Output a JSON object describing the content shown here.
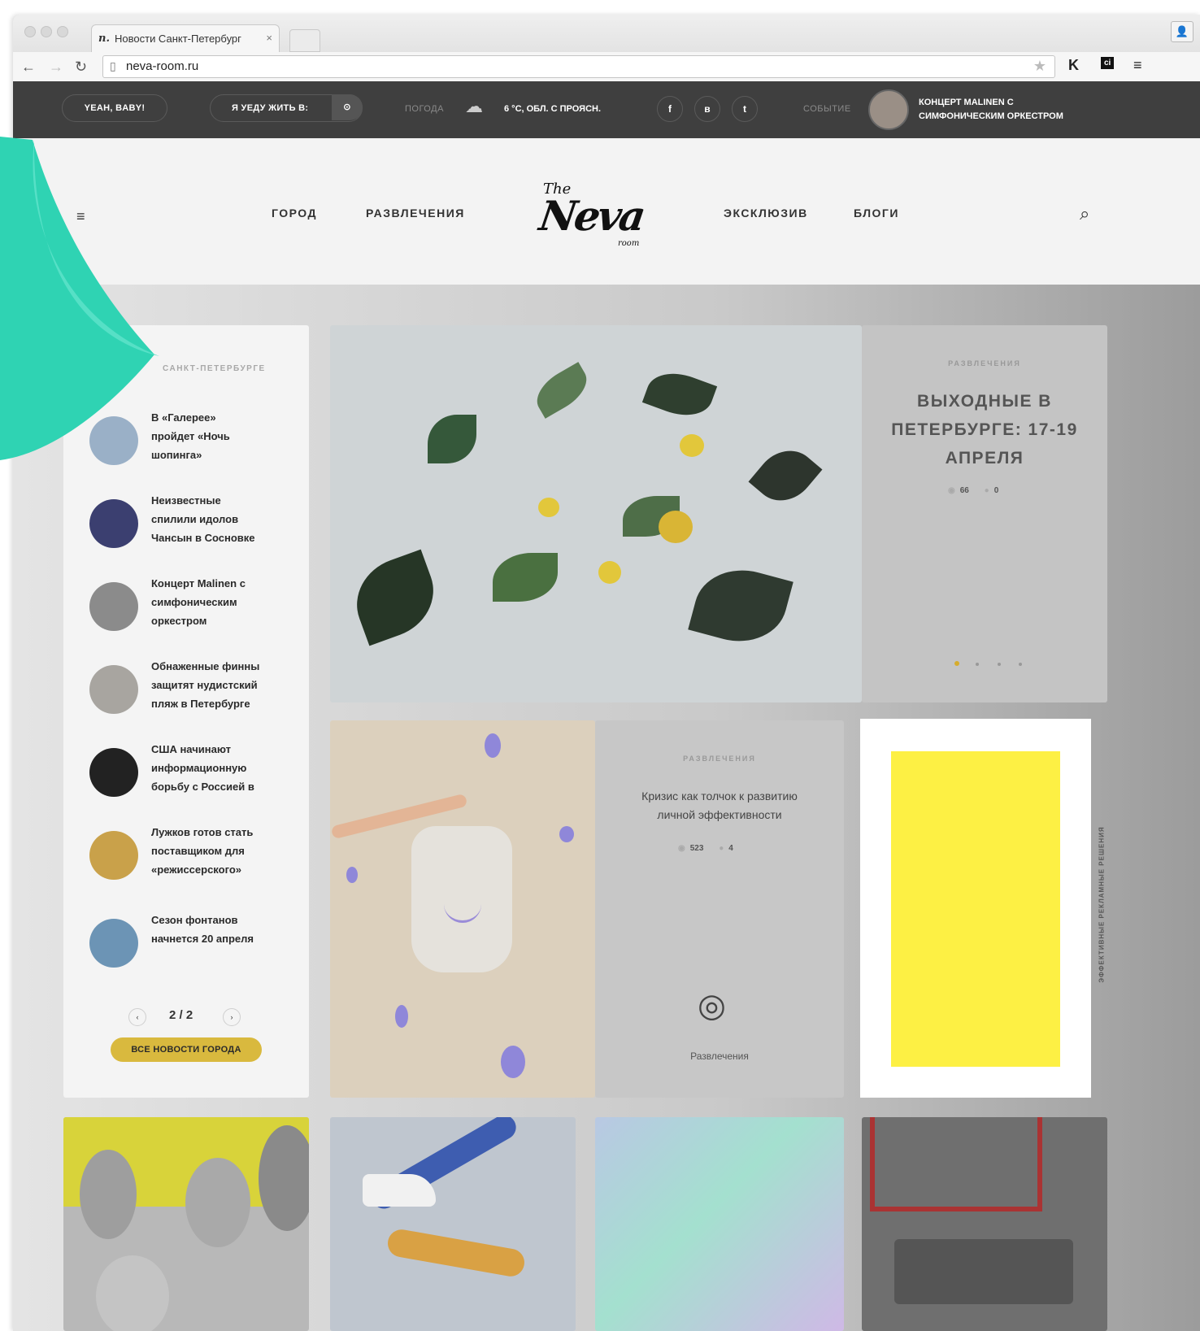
{
  "browser": {
    "tab_title": "Новости Санкт-Петербург",
    "tab_favicon": "n.",
    "tab_close": "×",
    "url": "neva-room.ru",
    "profile_icon": "person-icon",
    "ext_k": "K",
    "ext_ci": "ci",
    "menu": "≡"
  },
  "topbar": {
    "yeah_label": "YEAH, BABY!",
    "leave_label": "Я УЕДУ ЖИТЬ В:",
    "weather_label": "ПОГОДА",
    "weather_value": "6 °C, ОБЛ. С ПРОЯСН.",
    "social": [
      "f",
      "в",
      "t"
    ],
    "event_label": "СОБЫТИЕ",
    "event_text_1": "КОНЦЕРТ MALINEN С",
    "event_text_2": "СИМФОНИЧЕСКИМ ОРКЕСТРОМ"
  },
  "nav": {
    "city": "ГОРОД",
    "entertainment": "РАЗВЛЕЧЕНИЯ",
    "exclusive": "ЭКСКЛЮЗИВ",
    "blogs": "БЛОГИ",
    "logo_the": "The",
    "logo_main": "Neva",
    "logo_room": "room"
  },
  "news": {
    "title": "САНКТ-ПЕТЕРБУРГЕ",
    "items": [
      {
        "lines": [
          "В «Галерее»",
          "пройдет «Ночь",
          "шопинга»"
        ],
        "color": "#9ab0c7"
      },
      {
        "lines": [
          "Неизвестные",
          "спилили идолов",
          "Чансын в Сосновке"
        ],
        "color": "#3b3f70"
      },
      {
        "lines": [
          "Концерт Malinen с",
          "симфоническим",
          "оркестром"
        ],
        "color": "#8b8b8b"
      },
      {
        "lines": [
          "Обнаженные финны",
          "защитят нудистский",
          "пляж в Петербурге"
        ],
        "color": "#a8a5a0"
      },
      {
        "lines": [
          "США начинают",
          "информационную",
          "борьбу с Россией в"
        ],
        "color": "#222222"
      },
      {
        "lines": [
          "Лужков готов стать",
          "поставщиком для",
          "«режиссерского»"
        ],
        "color": "#c9a14a"
      },
      {
        "lines": [
          "Сезон фонтанов",
          "начнется 20 апреля"
        ],
        "color": "#6c94b5"
      }
    ],
    "pager": "2 / 2",
    "prev": "‹",
    "next": "›",
    "all_button": "ВСЕ НОВОСТИ ГОРОДА"
  },
  "feature": {
    "category": "РАЗВЛЕЧЕНИЯ",
    "title_1": "ВЫХОДНЫЕ В",
    "title_2": "ПЕТЕРБУРГЕ: 17-19",
    "title_3": "АПРЕЛЯ",
    "views": "66",
    "comments": "0"
  },
  "article": {
    "category": "РАЗВЛЕЧЕНИЯ",
    "title_1": "Кризис как толчок к развитию",
    "title_2": "личной эффективности",
    "views": "523",
    "comments": "4",
    "rubric": "Развлечения"
  },
  "ad": {
    "side_text": "ЭФФЕКТИВНЫЕ РЕКЛАМНЫЕ РЕШЕНИЯ",
    "fill_color": "#fdf044"
  },
  "accent": "#2fd3b3"
}
